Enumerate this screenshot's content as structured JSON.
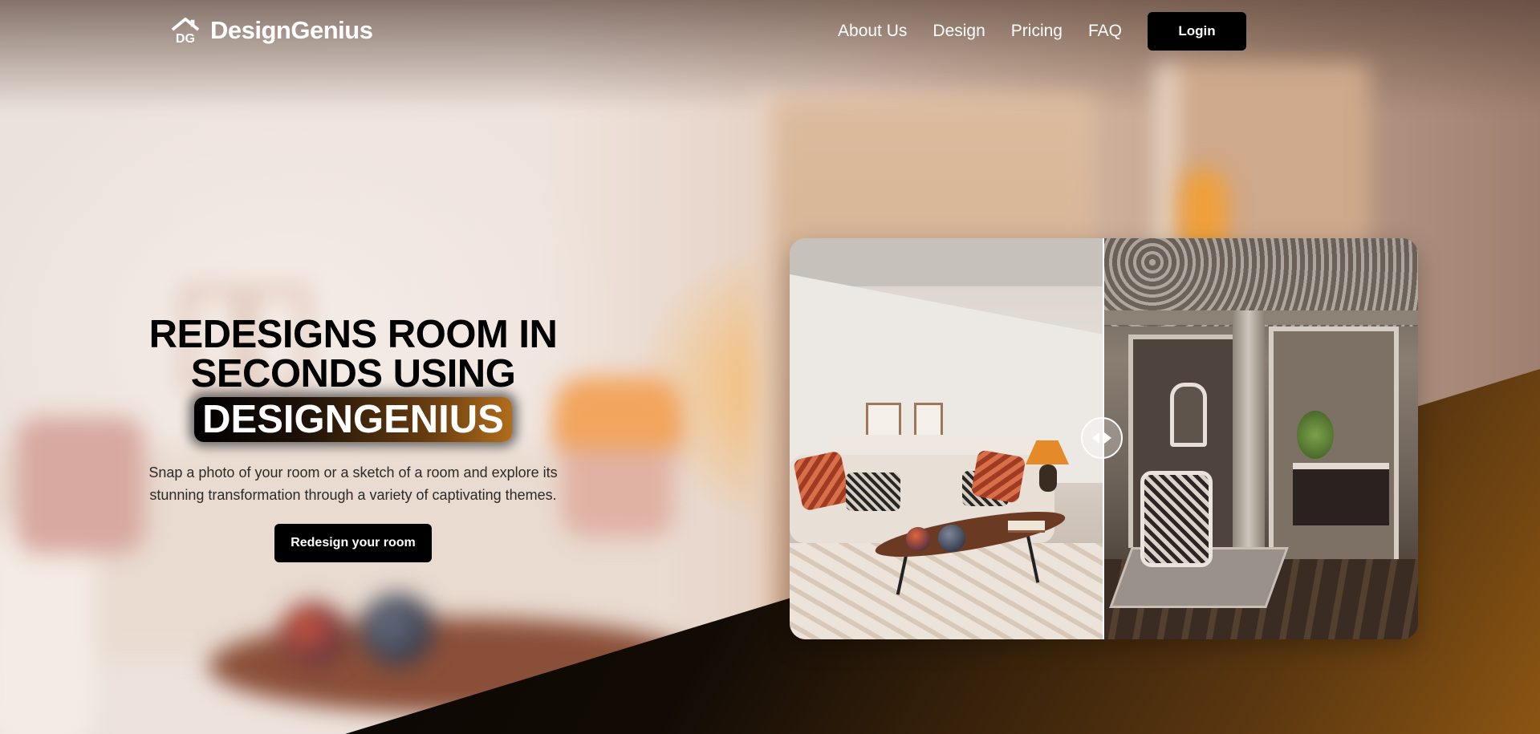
{
  "nav": {
    "brand": "DesignGenius",
    "logo_icon": "house-logo-icon",
    "links": [
      "About Us",
      "Design",
      "Pricing",
      "FAQ"
    ],
    "login_label": "Login"
  },
  "hero": {
    "title_line1": "REDESIGNS ROOM IN",
    "title_line2": "SECONDS USING",
    "highlight": "DESIGNGENIUS",
    "subtitle_line1": "Snap a photo of your room or a sketch of a room and explore its",
    "subtitle_line2": "stunning transformation through a variety of captivating themes.",
    "cta_label": "Redesign your room"
  },
  "compare": {
    "slider_position": 0.5,
    "handle_icon": "left-right-arrows-icon"
  },
  "colors": {
    "primary": "#000000",
    "accent_gold": "#8a5512",
    "text_light": "#ffffff",
    "text_dark": "#2b2b2b"
  }
}
